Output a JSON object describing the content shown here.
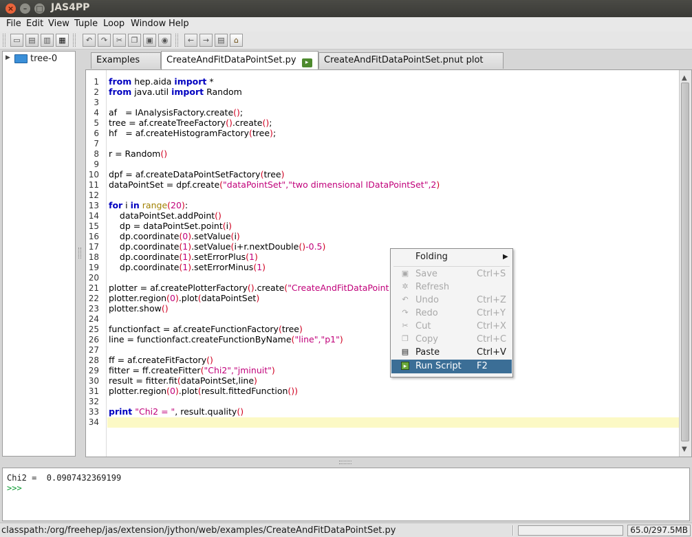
{
  "window": {
    "title": "JAS4PP"
  },
  "menubar": [
    "File",
    "Edit",
    "View",
    "Tuple",
    "Loop",
    "Window",
    "Help"
  ],
  "toolbar": {
    "icons": [
      "new-icon",
      "open-icon",
      "save-icon",
      "save-all-icon",
      "print-icon",
      "undo-icon",
      "redo-icon",
      "cut-icon",
      "copy-icon",
      "paste-icon",
      "find-icon",
      "back-icon",
      "forward-icon",
      "page-icon",
      "home-icon"
    ]
  },
  "tree": {
    "root": "tree-0"
  },
  "tabs": [
    {
      "label": "Examples",
      "icon": "globe-icon"
    },
    {
      "label": "CreateAndFitDataPointSet.py",
      "icon": "run-script-icon"
    },
    {
      "label": "CreateAndFitDataPointSet.pnut plot",
      "icon": "plot-icon"
    }
  ],
  "editor": {
    "line_numbers": [
      "1",
      "2",
      "3",
      "4",
      "5",
      "6",
      "7",
      "8",
      "9",
      "10",
      "11",
      "12",
      "13",
      "14",
      "15",
      "16",
      "17",
      "18",
      "19",
      "20",
      "21",
      "22",
      "23",
      "24",
      "25",
      "26",
      "27",
      "28",
      "29",
      "30",
      "31",
      "32",
      "33",
      "34"
    ],
    "t": {
      "kw_from": "from",
      "kw_import": "import",
      "kw_for": "for",
      "kw_in": "in",
      "kw_print": "print",
      "l1a": " hep.aida ",
      "l1b": " *",
      "l2a": " java.util ",
      "l2b": " Random",
      "l4a": "af   = IAnalysisFactory.create",
      "l4b": ";",
      "l5a": "tree = af.createTreeFactory",
      "l5b": ".create",
      "l5c": ";",
      "l6a": "hf   = af.createHistogramFactory",
      "l6b": "tree",
      "l6c": ";",
      "l8a": "r = Random",
      "l10a": "dpf = af.createDataPointSetFactory",
      "l10b": "tree",
      "l11a": "dataPointSet = dpf.create",
      "l11b": "\"dataPointSet\"",
      "l11c": ",",
      "l11d": "\"two dimensional IDataPointSet\"",
      "l11e": ",2",
      "l13a": " i ",
      "l13b": " ",
      "l13c": "range",
      "l13d": "20",
      "l13e": ":",
      "l14a": "    dataPointSet.addPoint",
      "l15a": "    dp = dataPointSet.point",
      "l15b": "i",
      "l16a": "    dp.coordinate",
      "l16b": "0",
      "l16c": ".setValue",
      "l16d": "i",
      "l17a": "    dp.coordinate",
      "l17b": "1",
      "l17c": ".setValue",
      "l17d": "i+r.nextDouble",
      "l17e": "-0.5",
      "l18a": "    dp.coordinate",
      "l18b": "1",
      "l18c": ".setErrorPlus",
      "l18d": "1",
      "l19a": "    dp.coordinate",
      "l19b": "1",
      "l19c": ".setErrorMinus",
      "l19d": "1",
      "l21a": "plotter = af.createPlotterFactory",
      "l21b": ".create",
      "l21c": "\"CreateAndFitDataPoint",
      "l22a": "plotter.region",
      "l22b": "0",
      "l22c": ".plot",
      "l22d": "dataPointSet",
      "l23a": "plotter.show",
      "l25a": "functionfact = af.createFunctionFactory",
      "l25b": "tree",
      "l26a": "line = functionfact.createFunctionByName",
      "l26b": "\"line\"",
      "l26c": ",",
      "l26d": "\"p1\"",
      "l28a": "ff = af.createFitFactory",
      "l29a": "fitter = ff.createFitter",
      "l29b": "\"Chi2\"",
      "l29c": ",",
      "l29d": "\"jminuit\"",
      "l30a": "result = fitter.fit",
      "l30b": "dataPointSet,line",
      "l31a": "plotter.region",
      "l31b": "0",
      "l31c": ".plot",
      "l31d": "result.fittedFunction",
      "l33a": " ",
      "l33b": "\"Chi2 = \"",
      "l33c": ", result.quality"
    }
  },
  "context_menu": {
    "items": [
      {
        "label": "Folding",
        "shortcut": "",
        "enabled": true,
        "submenu": true
      },
      {
        "label": "Save",
        "shortcut": "Ctrl+S",
        "enabled": false,
        "icon": "save-icon"
      },
      {
        "label": "Refresh",
        "shortcut": "",
        "enabled": false,
        "icon": "refresh-icon"
      },
      {
        "label": "Undo",
        "shortcut": "Ctrl+Z",
        "enabled": false,
        "icon": "undo-icon"
      },
      {
        "label": "Redo",
        "shortcut": "Ctrl+Y",
        "enabled": false,
        "icon": "redo-icon"
      },
      {
        "label": "Cut",
        "shortcut": "Ctrl+X",
        "enabled": false,
        "icon": "cut-icon"
      },
      {
        "label": "Copy",
        "shortcut": "Ctrl+C",
        "enabled": false,
        "icon": "copy-icon"
      },
      {
        "label": "Paste",
        "shortcut": "Ctrl+V",
        "enabled": true,
        "icon": "paste-icon"
      },
      {
        "label": "Run Script",
        "shortcut": "F2",
        "enabled": true,
        "selected": true,
        "icon": "run-script-icon"
      }
    ]
  },
  "console": {
    "output": "Chi2 =  0.0907432369199",
    "prompt": ">>>"
  },
  "status": {
    "path": "classpath:/org/freehep/jas/extension/jython/web/examples/CreateAndFitDataPointSet.py",
    "memory": "65.0/297.5MB"
  }
}
